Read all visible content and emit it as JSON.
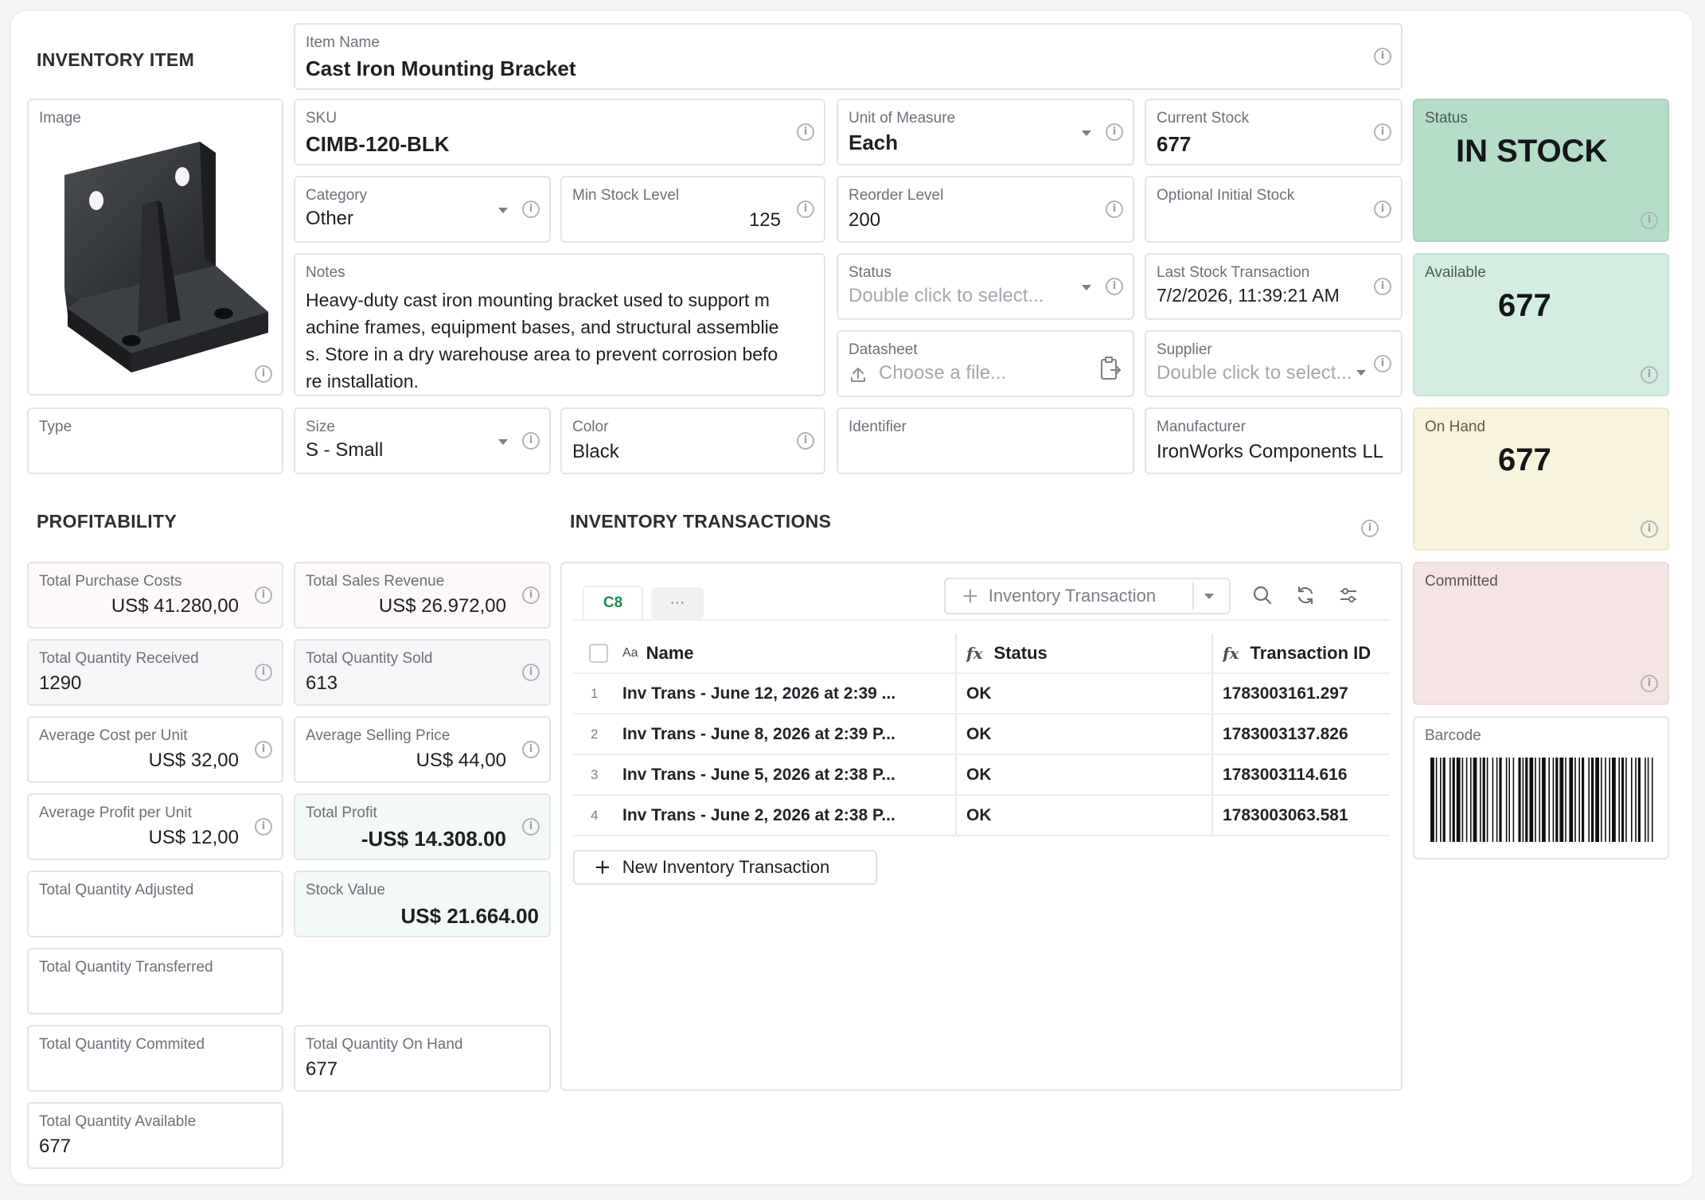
{
  "section_inventory_item": "INVENTORY ITEM",
  "item_name": {
    "label": "Item Name",
    "value": "Cast Iron Mounting Bracket"
  },
  "image": {
    "label": "Image"
  },
  "sku": {
    "label": "SKU",
    "value": "CIMB-120-BLK"
  },
  "unit_of_measure": {
    "label": "Unit of Measure",
    "value": "Each"
  },
  "current_stock": {
    "label": "Current Stock",
    "value": "677"
  },
  "status_card": {
    "label": "Status",
    "value": "IN STOCK",
    "color": "#b4ddc8"
  },
  "category": {
    "label": "Category",
    "value": "Other"
  },
  "min_stock_level": {
    "label": "Min Stock Level",
    "value": "125"
  },
  "reorder_level": {
    "label": "Reorder Level",
    "value": "200"
  },
  "optional_initial_stock": {
    "label": "Optional Initial Stock",
    "value": ""
  },
  "available_card": {
    "label": "Available",
    "value": "677",
    "color": "#d3ede1"
  },
  "notes": {
    "label": "Notes",
    "lines": [
      "Heavy-duty cast iron mounting bracket used to support m",
      "achine frames, equipment bases, and structural assemblie",
      "s. Store in a dry warehouse area to prevent corrosion befo",
      "re installation."
    ]
  },
  "status_select": {
    "label": "Status",
    "placeholder": "Double click to select..."
  },
  "last_stock_transaction": {
    "label": "Last Stock Transaction",
    "value": "7/2/2026, 11:39:21 AM"
  },
  "datasheet": {
    "label": "Datasheet",
    "placeholder": "Choose a file..."
  },
  "supplier": {
    "label": "Supplier",
    "placeholder": "Double click to select..."
  },
  "type": {
    "label": "Type",
    "value": ""
  },
  "size": {
    "label": "Size",
    "value": "S - Small"
  },
  "color_field": {
    "label": "Color",
    "value": "Black"
  },
  "identifier": {
    "label": "Identifier",
    "value": ""
  },
  "manufacturer": {
    "label": "Manufacturer",
    "value": "IronWorks Components LL"
  },
  "on_hand_card": {
    "label": "On Hand",
    "value": "677",
    "color": "#f8f3dd"
  },
  "committed_card": {
    "label": "Committed",
    "value": "",
    "color": "#f6e4e4"
  },
  "barcode": {
    "label": "Barcode"
  },
  "section_profitability": "PROFITABILITY",
  "section_transactions": "INVENTORY TRANSACTIONS",
  "profitability": {
    "total_purchase_costs": {
      "label": "Total Purchase Costs",
      "value": "US$ 41.280,00"
    },
    "total_sales_revenue": {
      "label": "Total Sales Revenue",
      "value": "US$ 26.972,00"
    },
    "total_quantity_received": {
      "label": "Total Quantity Received",
      "value": "1290"
    },
    "total_quantity_sold": {
      "label": "Total Quantity Sold",
      "value": "613"
    },
    "average_cost_per_unit": {
      "label": "Average Cost per Unit",
      "value": "US$ 32,00"
    },
    "average_selling_price": {
      "label": "Average Selling Price",
      "value": "US$ 44,00"
    },
    "average_profit_per_unit": {
      "label": "Average Profit per Unit",
      "value": "US$ 12,00"
    },
    "total_profit": {
      "label": "Total Profit",
      "value": "-US$ 14.308.00"
    },
    "total_quantity_adjusted": {
      "label": "Total Quantity Adjusted",
      "value": ""
    },
    "stock_value": {
      "label": "Stock Value",
      "value": "US$ 21.664.00"
    },
    "total_quantity_transferred": {
      "label": "Total Quantity Transferred",
      "value": ""
    },
    "total_quantity_commited": {
      "label": "Total Quantity Commited",
      "value": ""
    },
    "total_quantity_on_hand": {
      "label": "Total Quantity On Hand",
      "value": "677"
    },
    "total_quantity_available": {
      "label": "Total Quantity Available",
      "value": "677"
    }
  },
  "transactions": {
    "tab_active": "C8",
    "tab_more": "···",
    "add_button": "Inventory Transaction",
    "columns": {
      "name": "Name",
      "status": "Status",
      "transaction_id": "Transaction ID"
    },
    "col_icons": {
      "name": "Aa",
      "status": "fx",
      "transaction_id": "fx"
    },
    "rows": [
      {
        "num": "1",
        "name": "Inv Trans - June 12, 2026 at 2:39 ...",
        "status": "OK",
        "id": "1783003161.297"
      },
      {
        "num": "2",
        "name": "Inv Trans - June 8, 2026 at 2:39 P...",
        "status": "OK",
        "id": "1783003137.826"
      },
      {
        "num": "3",
        "name": "Inv Trans - June 5, 2026 at 2:38 P...",
        "status": "OK",
        "id": "1783003114.616"
      },
      {
        "num": "4",
        "name": "Inv Trans - June 2, 2026 at 2:38 P...",
        "status": "OK",
        "id": "1783003063.581"
      }
    ],
    "new_button": "New Inventory Transaction"
  },
  "colors": {
    "accent_green": "#1f8a4c",
    "status_green": "#b4ddc8",
    "available_green": "#d3ede1",
    "on_hand_yellow": "#f8f3dd",
    "committed_red": "#f6e4e4"
  }
}
